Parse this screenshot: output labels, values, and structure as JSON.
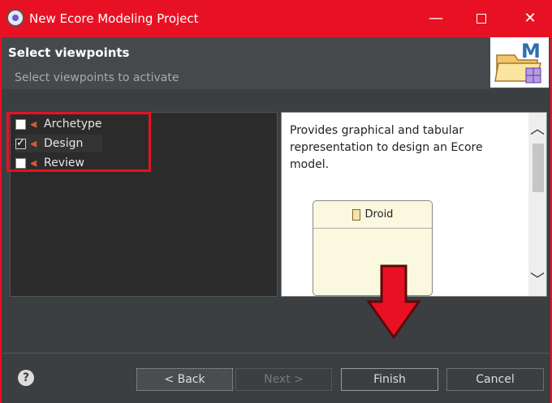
{
  "window": {
    "title": "New Ecore Modeling Project",
    "minimize": "—",
    "close": "✕"
  },
  "header": {
    "title": "Select viewpoints",
    "subtitle": "Select viewpoints to activate"
  },
  "viewpoints": [
    {
      "label": "Archetype",
      "checked": false
    },
    {
      "label": "Design",
      "checked": true
    },
    {
      "label": "Review",
      "checked": false
    }
  ],
  "description": {
    "text": "Provides graphical and tabular representation to design an Ecore model.",
    "preview_class": "Droid"
  },
  "buttons": {
    "help": "?",
    "back": "< Back",
    "next": "Next >",
    "finish": "Finish",
    "cancel": "Cancel"
  },
  "colors": {
    "accent_red": "#e81123",
    "dialog_bg": "#3c3f41",
    "viewpoint_icon": "#e8603c"
  },
  "icons": {
    "app": "eclipse-icon",
    "viewpoint": "sirius-viewpoint-icon",
    "annotation": "red-down-arrow"
  }
}
